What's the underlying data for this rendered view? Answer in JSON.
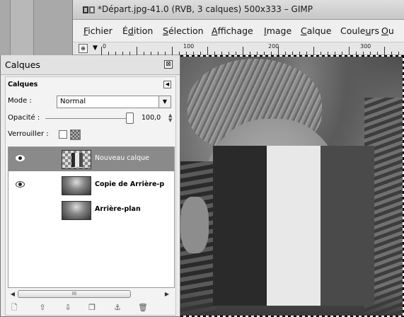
{
  "main_window": {
    "title": "*Départ.jpg-41.0 (RVB, 3 calques) 500x333 – GIMP",
    "menu": [
      {
        "label": "Fichier",
        "key": "F",
        "rest": "ichier"
      },
      {
        "label": "Édition",
        "key": "d",
        "pre": "É",
        "rest": "ition"
      },
      {
        "label": "Sélection",
        "key": "S",
        "rest": "élection"
      },
      {
        "label": "Affichage",
        "key": "A",
        "rest": "ffichage"
      },
      {
        "label": "Image",
        "key": "I",
        "rest": "mage"
      },
      {
        "label": "Calque",
        "key": "C",
        "rest": "alque"
      },
      {
        "label": "Couleurs",
        "pre": "Coule",
        "key": "u",
        "rest": "rs"
      },
      {
        "label": "Ou",
        "key": "O",
        "rest": "u"
      }
    ],
    "ruler_labels": [
      "0",
      "100",
      "200",
      "300"
    ]
  },
  "layers_dock": {
    "title": "Calques",
    "tab_label": "Calques",
    "mode_label": "Mode :",
    "mode_value": "Normal",
    "opacity_label": "Opacité :",
    "opacity_value": "100,0",
    "lock_label": "Verrouiller :",
    "layers": [
      {
        "name": "Nouveau calque",
        "visible": true,
        "selected": true,
        "thumb": "checker-flag"
      },
      {
        "name": "Copie de Arrière-p",
        "visible": true,
        "selected": false,
        "thumb": "photo"
      },
      {
        "name": "Arrière-plan",
        "visible": false,
        "selected": false,
        "thumb": "photo"
      }
    ],
    "scrollbar_grip": "III",
    "bottom_icons": [
      "new-layer-icon",
      "raise-layer-icon",
      "lower-layer-icon",
      "duplicate-layer-icon",
      "anchor-layer-icon",
      "delete-layer-icon"
    ]
  },
  "flag_colors": [
    "#2a2a2a",
    "#e8e8e8",
    "#4a4a4a"
  ]
}
